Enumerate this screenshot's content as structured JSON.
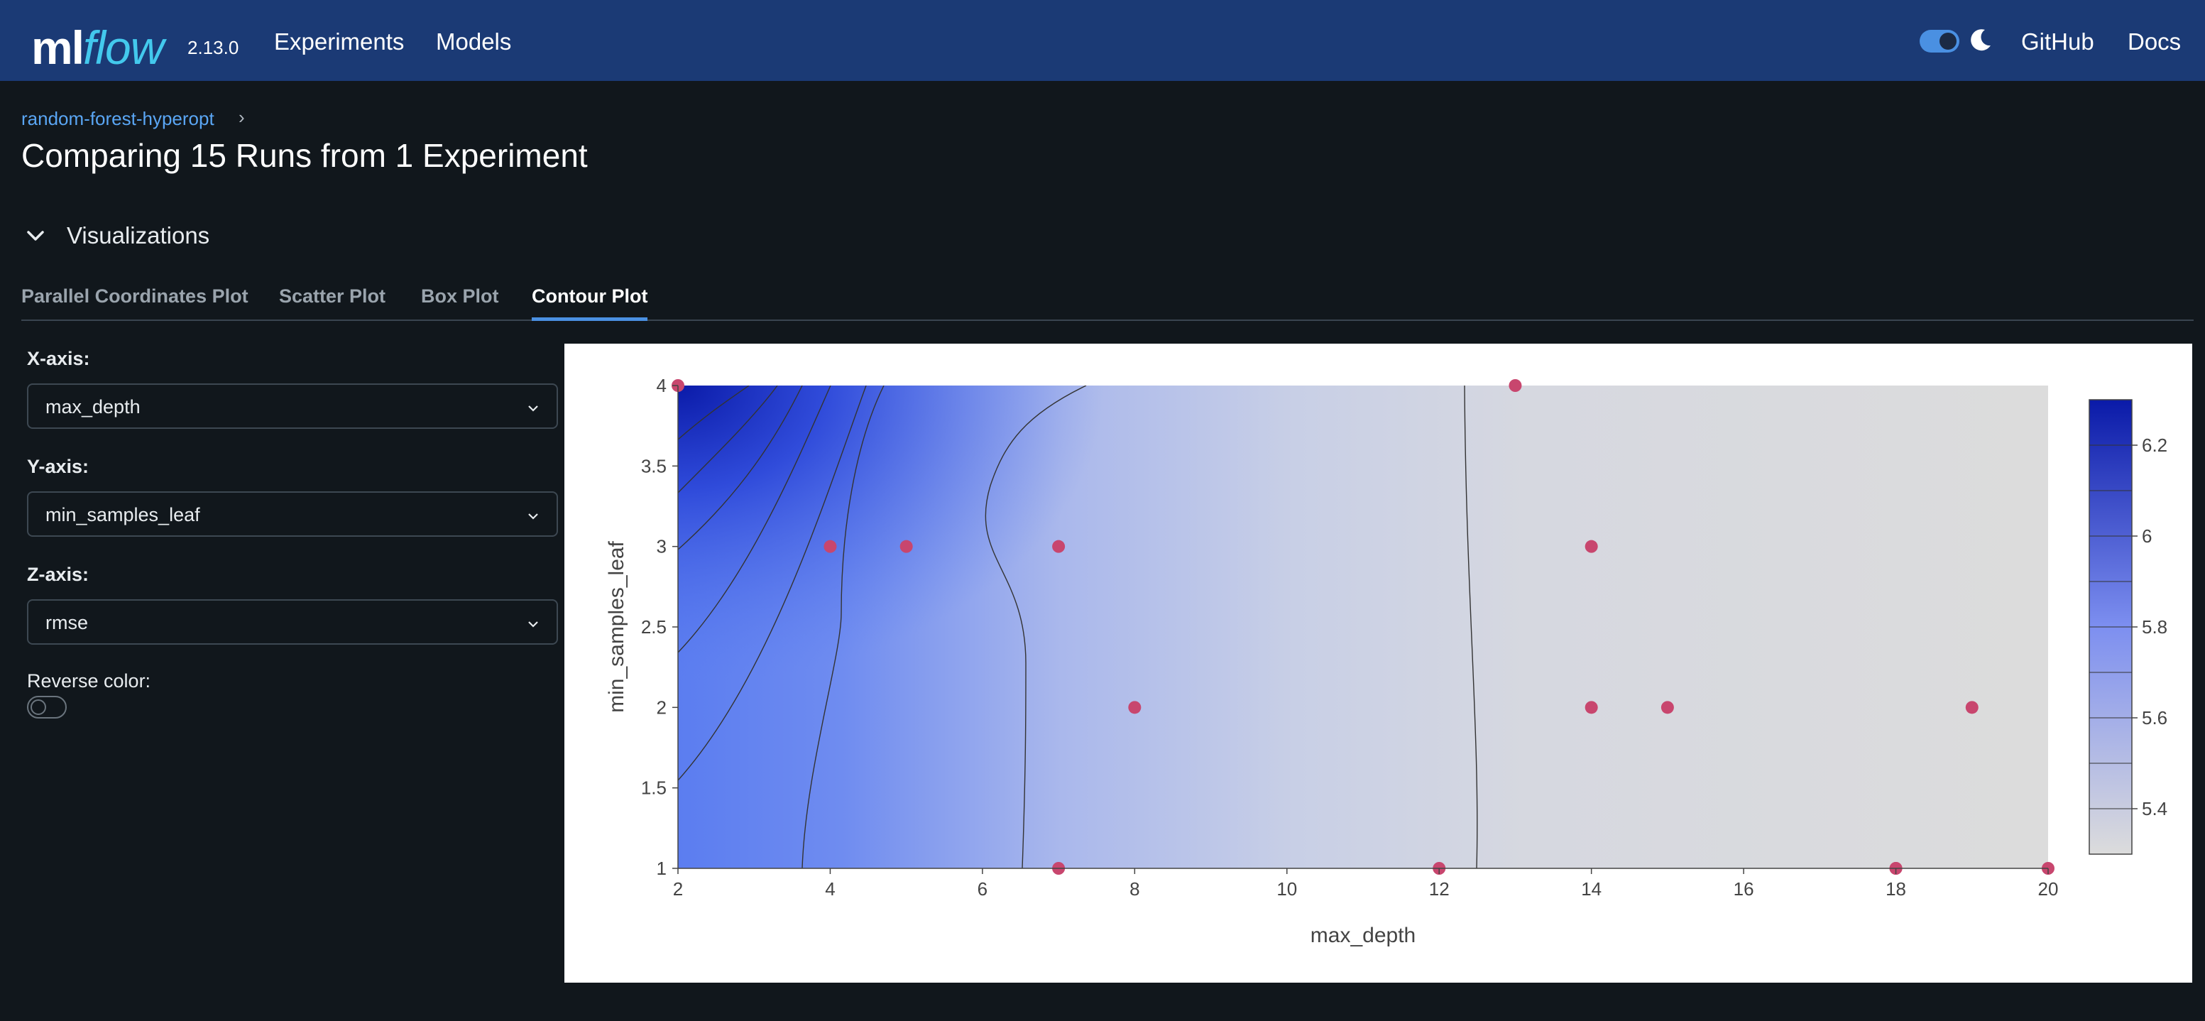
{
  "header": {
    "logo_ml": "ml",
    "logo_flow": "flow",
    "version": "2.13.0",
    "nav": [
      "Experiments",
      "Models"
    ],
    "right_links": [
      "GitHub",
      "Docs"
    ],
    "theme_toggle": "on",
    "brand_color": "#1b3a75",
    "accent_color": "#43c9ed"
  },
  "breadcrumb": {
    "experiment": "random-forest-hyperopt",
    "separator": "›"
  },
  "page_title": "Comparing 15 Runs from 1 Experiment",
  "section": {
    "title": "Visualizations",
    "icon": "chevron-down-icon"
  },
  "tabs": [
    {
      "label": "Parallel Coordinates Plot",
      "active": false
    },
    {
      "label": "Scatter Plot",
      "active": false
    },
    {
      "label": "Box Plot",
      "active": false
    },
    {
      "label": "Contour Plot",
      "active": true
    }
  ],
  "controls": {
    "x_label": "X-axis:",
    "x_value": "max_depth",
    "y_label": "Y-axis:",
    "y_value": "min_samples_leaf",
    "z_label": "Z-axis:",
    "z_value": "rmse",
    "reverse_label": "Reverse color:",
    "reverse_on": false
  },
  "chart_data": {
    "type": "contour",
    "xlabel": "max_depth",
    "ylabel": "min_samples_leaf",
    "xlim": [
      2,
      20
    ],
    "ylim": [
      1,
      4
    ],
    "xticks": [
      2,
      4,
      6,
      8,
      10,
      12,
      14,
      16,
      18,
      20
    ],
    "yticks": [
      1,
      1.5,
      2,
      2.5,
      3,
      3.5,
      4
    ],
    "ytick_labels": [
      "1",
      "1.5",
      "2",
      "2.5",
      "3",
      "3.5",
      "4"
    ],
    "colorbar": {
      "ticks": [
        5.4,
        5.6,
        5.8,
        6,
        6.2
      ],
      "range": [
        5.3,
        6.3
      ],
      "low_color": "#dcdcdc",
      "high_color": "#0a1aa8"
    },
    "point_color": "#c8466e",
    "points": [
      {
        "x": 4,
        "y": 3
      },
      {
        "x": 5,
        "y": 3
      },
      {
        "x": 7,
        "y": 3
      },
      {
        "x": 8,
        "y": 2
      },
      {
        "x": 7,
        "y": 1
      },
      {
        "x": 12,
        "y": 1
      },
      {
        "x": 13,
        "y": 4
      },
      {
        "x": 14,
        "y": 3
      },
      {
        "x": 14,
        "y": 2
      },
      {
        "x": 15,
        "y": 2
      },
      {
        "x": 18,
        "y": 1
      },
      {
        "x": 18,
        "y": 1
      },
      {
        "x": 19,
        "y": 2
      },
      {
        "x": 20,
        "y": 1
      },
      {
        "x": 2,
        "y": 4
      }
    ]
  }
}
